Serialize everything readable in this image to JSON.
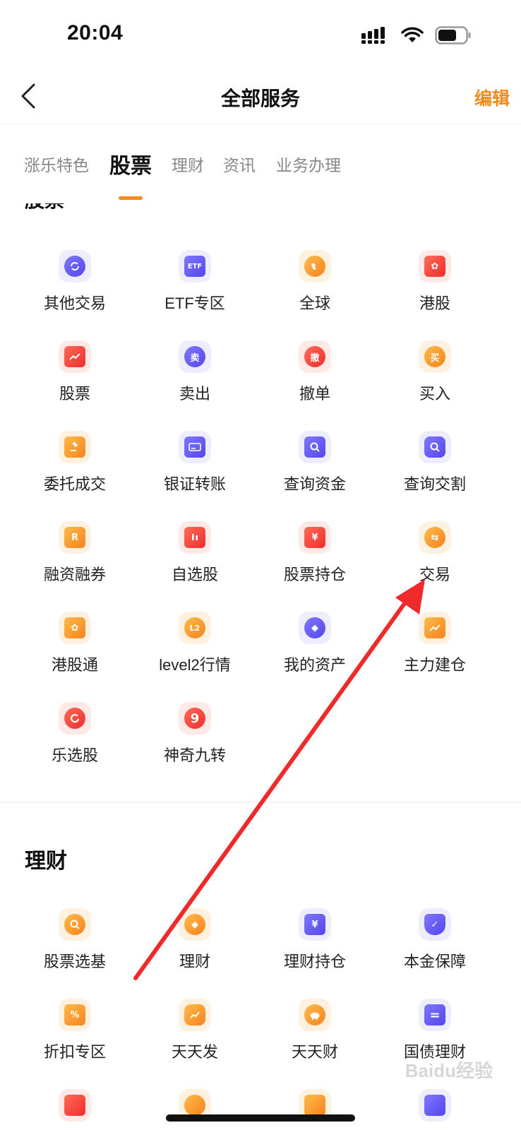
{
  "status_bar": {
    "time": "20:04"
  },
  "header": {
    "title": "全部服务",
    "edit_label": "编辑"
  },
  "tabs": [
    {
      "label": "涨乐特色",
      "active": false
    },
    {
      "label": "股票",
      "active": true
    },
    {
      "label": "理财",
      "active": false
    },
    {
      "label": "资讯",
      "active": false
    },
    {
      "label": "业务办理",
      "active": false
    }
  ],
  "sections": {
    "stocks": {
      "title": "股票",
      "items": [
        {
          "label": "其他交易",
          "icon": "swap-icon"
        },
        {
          "label": "ETF专区",
          "icon": "etf-icon",
          "glyph": "ETF"
        },
        {
          "label": "全球",
          "icon": "globe-icon"
        },
        {
          "label": "港股",
          "icon": "hk-flower-icon",
          "glyph": "✿"
        },
        {
          "label": "股票",
          "icon": "stock-chart-icon"
        },
        {
          "label": "卖出",
          "icon": "sell-icon",
          "glyph": "卖"
        },
        {
          "label": "撤单",
          "icon": "cancel-order-icon",
          "glyph": "撤"
        },
        {
          "label": "买入",
          "icon": "buy-icon",
          "glyph": "买"
        },
        {
          "label": "委托成交",
          "icon": "gavel-icon"
        },
        {
          "label": "银证转账",
          "icon": "card-icon"
        },
        {
          "label": "查询资金",
          "icon": "search-funds-icon"
        },
        {
          "label": "查询交割",
          "icon": "search-delivery-icon"
        },
        {
          "label": "融资融券",
          "icon": "margin-ticket-icon",
          "glyph": "R"
        },
        {
          "label": "自选股",
          "icon": "bookmark-candles-icon"
        },
        {
          "label": "股票持仓",
          "icon": "house-yen-icon",
          "glyph": "¥"
        },
        {
          "label": "交易",
          "icon": "exchange-icon",
          "glyph": "⇆"
        },
        {
          "label": "港股通",
          "icon": "hk-connect-icon",
          "glyph": "✿"
        },
        {
          "label": "level2行情",
          "icon": "level2-icon",
          "glyph": "L2"
        },
        {
          "label": "我的资产",
          "icon": "money-bag-icon",
          "glyph": "◆"
        },
        {
          "label": "主力建仓",
          "icon": "trend-up-icon"
        },
        {
          "label": "乐选股",
          "icon": "le-select-icon"
        },
        {
          "label": "神奇九转",
          "icon": "nine-turns-icon",
          "glyph": "9"
        }
      ]
    },
    "wealth": {
      "title": "理财",
      "items": [
        {
          "label": "股票选基",
          "icon": "fund-search-icon"
        },
        {
          "label": "理财",
          "icon": "wealth-coin-icon",
          "glyph": "◆"
        },
        {
          "label": "理财持仓",
          "icon": "wealth-holdings-icon",
          "glyph": "¥"
        },
        {
          "label": "本金保障",
          "icon": "shield-check-icon",
          "glyph": "✓"
        },
        {
          "label": "折扣专区",
          "icon": "discount-icon",
          "glyph": "%"
        },
        {
          "label": "天天发",
          "icon": "daily-gain-icon"
        },
        {
          "label": "天天财",
          "icon": "piggy-bank-icon"
        },
        {
          "label": "国债理财",
          "icon": "bond-icon",
          "glyph": "="
        }
      ]
    }
  },
  "watermark": "Baidu经验"
}
